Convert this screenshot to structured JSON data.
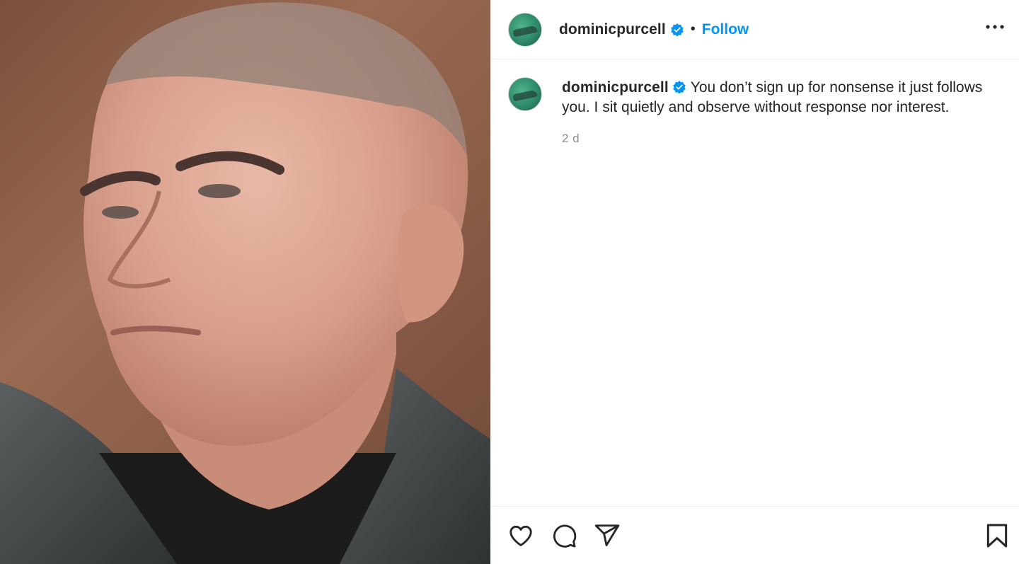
{
  "photo": {
    "alt_subject": "close-up portrait photo"
  },
  "header": {
    "username": "dominicpurcell",
    "separator": "•",
    "follow_label": "Follow",
    "more_icon": "more-options-icon"
  },
  "caption": {
    "username": "dominicpurcell",
    "text": "You don’t sign up for nonsense it just follows you. I sit quietly and observe without response nor interest.",
    "time": "2 d"
  },
  "actions": {
    "icons": [
      "heart-icon",
      "comment-icon",
      "share-icon",
      "bookmark-icon"
    ]
  },
  "colors": {
    "follow": "#0095f6",
    "verified": "#0095f6",
    "text": "#262626",
    "muted": "#8e8e8e"
  }
}
